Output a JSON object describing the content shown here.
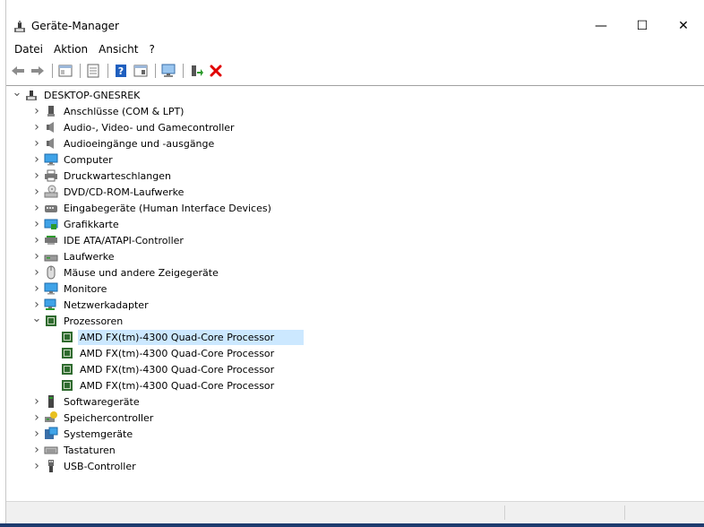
{
  "window": {
    "title": "Geräte-Manager",
    "minimize_glyph": "—",
    "maximize_glyph": "☐",
    "close_glyph": "✕"
  },
  "menu": [
    "Datei",
    "Aktion",
    "Ansicht",
    "?"
  ],
  "toolbar": {
    "buttons": [
      "back-arrow-icon",
      "forward-arrow-icon",
      "show-hide-console-tree-icon",
      "properties-icon",
      "help-icon",
      "action-pane-icon",
      "scan-hardware-icon",
      "update-driver-icon",
      "uninstall-device-icon"
    ]
  },
  "tree": {
    "root": {
      "label": "DESKTOP-GNESREK",
      "icon": "computer-icon"
    },
    "categories": [
      {
        "label": "Anschlüsse (COM & LPT)",
        "icon": "port-icon"
      },
      {
        "label": "Audio-, Video- und Gamecontroller",
        "icon": "speaker-icon"
      },
      {
        "label": "Audioeingänge und -ausgänge",
        "icon": "speaker-icon"
      },
      {
        "label": "Computer",
        "icon": "monitor-icon"
      },
      {
        "label": "Druckwarteschlangen",
        "icon": "printer-icon"
      },
      {
        "label": "DVD/CD-ROM-Laufwerke",
        "icon": "dvd-drive-icon"
      },
      {
        "label": "Eingabegeräte (Human Interface Devices)",
        "icon": "hid-icon"
      },
      {
        "label": "Grafikkarte",
        "icon": "display-adapter-icon"
      },
      {
        "label": "IDE ATA/ATAPI-Controller",
        "icon": "ide-controller-icon"
      },
      {
        "label": "Laufwerke",
        "icon": "disk-drive-icon"
      },
      {
        "label": "Mäuse und andere Zeigegeräte",
        "icon": "mouse-icon"
      },
      {
        "label": "Monitore",
        "icon": "monitor-icon"
      },
      {
        "label": "Netzwerkadapter",
        "icon": "network-adapter-icon"
      },
      {
        "label": "Prozessoren",
        "icon": "processor-icon",
        "expanded": true
      },
      {
        "label": "Softwaregeräte",
        "icon": "software-device-icon"
      },
      {
        "label": "Speichercontroller",
        "icon": "storage-controller-icon"
      },
      {
        "label": "Systemgeräte",
        "icon": "system-devices-icon"
      },
      {
        "label": "Tastaturen",
        "icon": "keyboard-icon"
      },
      {
        "label": "USB-Controller",
        "icon": "usb-icon"
      }
    ],
    "processors": [
      "AMD FX(tm)-4300 Quad-Core Processor",
      "AMD FX(tm)-4300 Quad-Core Processor",
      "AMD FX(tm)-4300 Quad-Core Processor",
      "AMD FX(tm)-4300 Quad-Core Processor"
    ],
    "selected_processor_index": 0
  },
  "colors": {
    "selection": "#cce8ff",
    "processor_green": "#2f6b2f",
    "delete_red": "#e00000",
    "help_blue": "#1f5fbf",
    "taskbar": "#1e3b6e"
  }
}
